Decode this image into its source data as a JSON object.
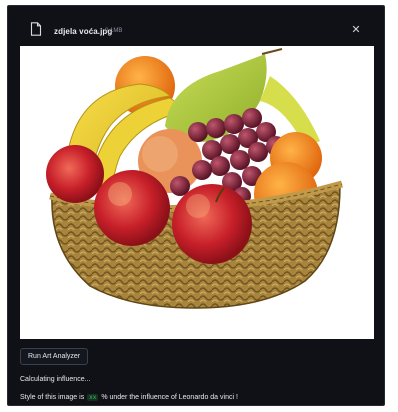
{
  "dialog": {
    "file_name": "zdjela voća.jpg",
    "file_size": "0.1MB",
    "close_glyph": "✕"
  },
  "image": {
    "subject": "fruit-basket-photo"
  },
  "actions": {
    "run_label": "Run Art Analyzer"
  },
  "status": {
    "calculating_text": "Calculating influence...",
    "result_prefix": "Style of this image is",
    "result_value": "xx",
    "result_suffix": "% under the influence of Leonardo da vinci !"
  },
  "colors": {
    "panel_bg": "#0f1117",
    "accent_green": "#34c46a"
  }
}
